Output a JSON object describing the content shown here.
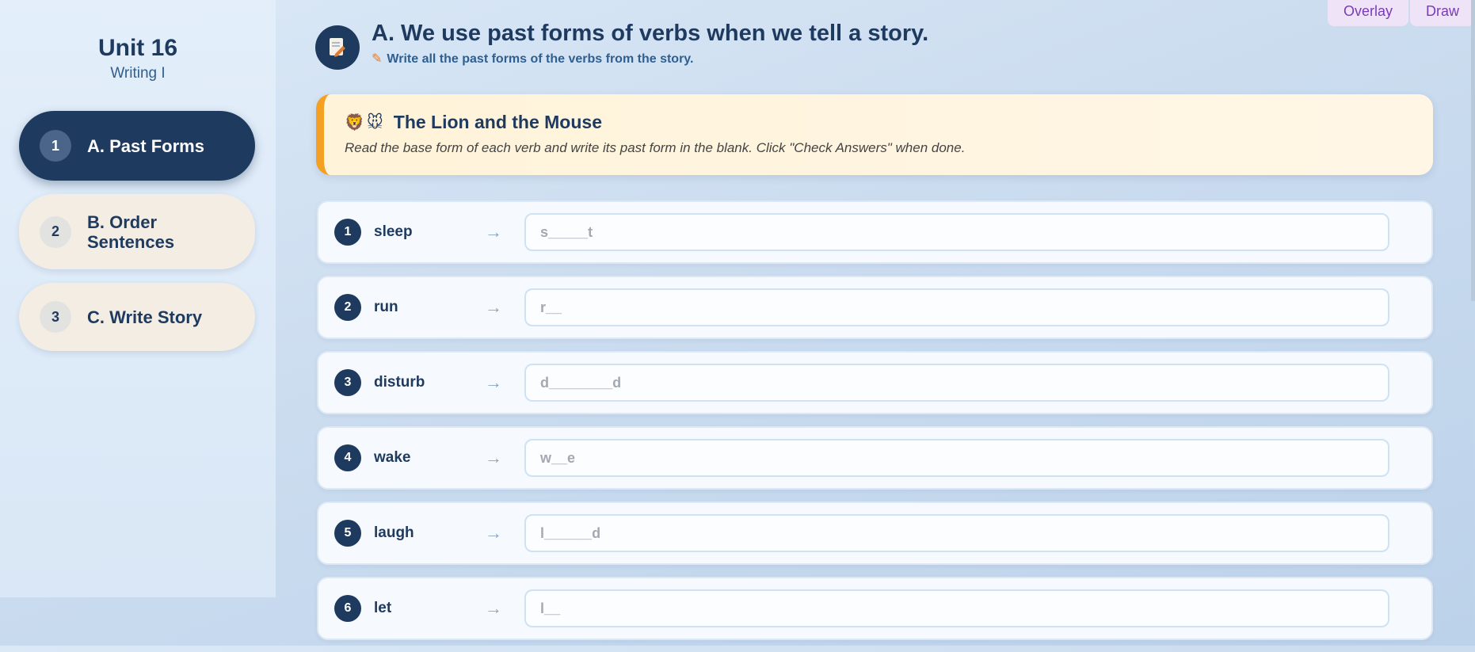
{
  "sidebar": {
    "unit_title": "Unit 16",
    "unit_subtitle": "Writing I",
    "items": [
      {
        "num": "1",
        "label": "A. Past Forms",
        "active": true
      },
      {
        "num": "2",
        "label": "B. Order Sentences",
        "active": false
      },
      {
        "num": "3",
        "label": "C. Write Story",
        "active": false
      }
    ]
  },
  "top_tabs": {
    "overlay": "Overlay",
    "draw": "Draw"
  },
  "header": {
    "icon": "document-pencil-icon",
    "title": "A. We use past forms of verbs when we tell a story.",
    "subtitle": "Write all the past forms of the verbs from the story."
  },
  "story": {
    "emoji": "🦁🐭",
    "title": "The Lion and the Mouse",
    "instructions": "Read the base form of each verb and write its past form in the blank. Click \"Check Answers\" when done."
  },
  "rows": [
    {
      "num": "1",
      "verb": "sleep",
      "arrow": "→",
      "placeholder": "s_____t",
      "value": ""
    },
    {
      "num": "2",
      "verb": "run",
      "arrow": "→",
      "placeholder": "r__",
      "value": ""
    },
    {
      "num": "3",
      "verb": "disturb",
      "arrow": "→",
      "placeholder": "d________d",
      "value": ""
    },
    {
      "num": "4",
      "verb": "wake",
      "arrow": "→",
      "placeholder": "w__e",
      "value": ""
    },
    {
      "num": "5",
      "verb": "laugh",
      "arrow": "→",
      "placeholder": "l______d",
      "value": ""
    },
    {
      "num": "6",
      "verb": "let",
      "arrow": "→",
      "placeholder": "l__",
      "value": ""
    }
  ],
  "colors": {
    "primary": "#1e3a5f",
    "accent": "#f3a024",
    "story_bg": "#fff3d9"
  }
}
